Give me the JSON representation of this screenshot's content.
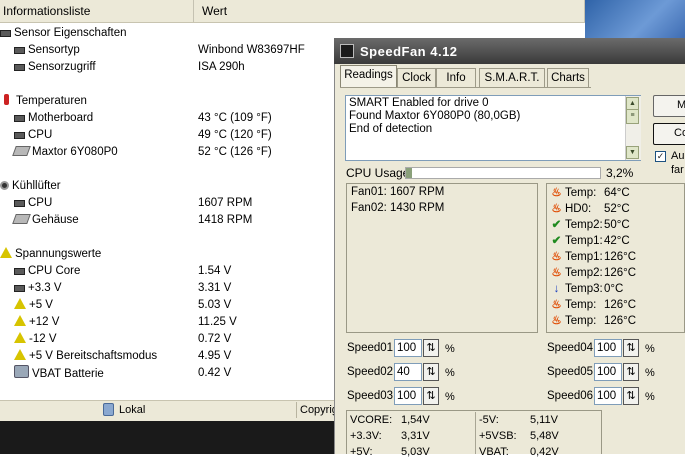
{
  "info_list": {
    "columns": {
      "name": "Informationsliste",
      "value": "Wert"
    },
    "groups": [
      {
        "title": "Sensor Eigenschaften",
        "icon": "chip-icon",
        "items": [
          {
            "name": "Sensortyp",
            "value": "Winbond W83697HF",
            "icon": "chip-icon"
          },
          {
            "name": "Sensorzugriff",
            "value": "ISA 290h",
            "icon": "chip-icon"
          }
        ]
      },
      {
        "title": "Temperaturen",
        "icon": "thermometer-icon",
        "items": [
          {
            "name": "Motherboard",
            "value": "43 °C  (109 °F)",
            "icon": "motherboard-icon"
          },
          {
            "name": "CPU",
            "value": "49 °C  (120 °F)",
            "icon": "cpu-icon"
          },
          {
            "name": "Maxtor 6Y080P0",
            "value": "52 °C  (126 °F)",
            "icon": "hard-drive-icon"
          }
        ]
      },
      {
        "title": "Kühllüfter",
        "icon": "fan-icon",
        "items": [
          {
            "name": "CPU",
            "value": "1607 RPM",
            "icon": "cpu-icon"
          },
          {
            "name": "Gehäuse",
            "value": "1418 RPM",
            "icon": "case-icon"
          }
        ]
      },
      {
        "title": "Spannungswerte",
        "icon": "voltage-icon",
        "items": [
          {
            "name": "CPU Core",
            "value": "1.54 V",
            "icon": "cpu-icon"
          },
          {
            "name": "+3.3 V",
            "value": "3.31 V",
            "icon": "cpu-icon"
          },
          {
            "name": "+5 V",
            "value": "5.03 V",
            "icon": "voltage-icon"
          },
          {
            "name": "+12 V",
            "value": "11.25 V",
            "icon": "voltage-icon"
          },
          {
            "name": "-12 V",
            "value": "0.72 V",
            "icon": "voltage-icon"
          },
          {
            "name": "+5 V Bereitschaftsmodus",
            "value": "4.95 V",
            "icon": "voltage-icon"
          },
          {
            "name": "VBAT Batterie",
            "value": "0.42 V",
            "icon": "battery-icon"
          }
        ]
      }
    ],
    "status": {
      "local": "Lokal",
      "copyright": "Copyrig"
    }
  },
  "speedfan": {
    "title": "SpeedFan 4.12",
    "tabs": [
      "Readings",
      "Clock",
      "Info",
      "S.M.A.R.T.",
      "Charts"
    ],
    "active_tab": "Readings",
    "log": "SMART Enabled for drive 0\nFound Maxtor 6Y080P0 (80,0GB)\nEnd of detection",
    "right_buttons": [
      "M",
      "Co"
    ],
    "auto_checkbox": {
      "checked": true,
      "line1": "Au",
      "line2": "far"
    },
    "cpu_usage": {
      "label": "CPU Usage",
      "value_text": "3,2%",
      "fraction": 0.032
    },
    "fans": [
      "Fan01: 1607 RPM",
      "Fan02: 1430 RPM"
    ],
    "temps": [
      {
        "name": "Temp:",
        "value": "64°C",
        "status": "fire"
      },
      {
        "name": "HD0:",
        "value": "52°C",
        "status": "fire"
      },
      {
        "name": "Temp2:",
        "value": "50°C",
        "status": "ok"
      },
      {
        "name": "Temp1:",
        "value": "42°C",
        "status": "ok"
      },
      {
        "name": "Temp1:",
        "value": "126°C",
        "status": "fire"
      },
      {
        "name": "Temp2:",
        "value": "126°C",
        "status": "fire"
      },
      {
        "name": "Temp3:",
        "value": "0°C",
        "status": "down"
      },
      {
        "name": "Temp:",
        "value": "126°C",
        "status": "fire"
      },
      {
        "name": "Temp:",
        "value": "126°C",
        "status": "fire"
      }
    ],
    "speeds": [
      {
        "label": "Speed01:",
        "value": "100",
        "unit": "%"
      },
      {
        "label": "Speed02:",
        "value": "40",
        "unit": "%"
      },
      {
        "label": "Speed03:",
        "value": "100",
        "unit": "%"
      },
      {
        "label": "Speed04:",
        "value": "100",
        "unit": "%"
      },
      {
        "label": "Speed05:",
        "value": "100",
        "unit": "%"
      },
      {
        "label": "Speed06:",
        "value": "100",
        "unit": "%"
      }
    ],
    "voltages_left": [
      {
        "label": "VCORE:",
        "value": "1,54V"
      },
      {
        "label": "+3.3V:",
        "value": "3,31V"
      },
      {
        "label": "+5V:",
        "value": "5,03V"
      }
    ],
    "voltages_right": [
      {
        "label": "-5V:",
        "value": "5,11V"
      },
      {
        "label": "+5VSB:",
        "value": "5,48V"
      },
      {
        "label": "VBAT:",
        "value": "0,42V"
      }
    ]
  },
  "colors": {
    "fire": "#e04a00",
    "ok": "#1f8a1f",
    "down": "#1a3fbf",
    "title_bar": "#4a4a4a"
  }
}
